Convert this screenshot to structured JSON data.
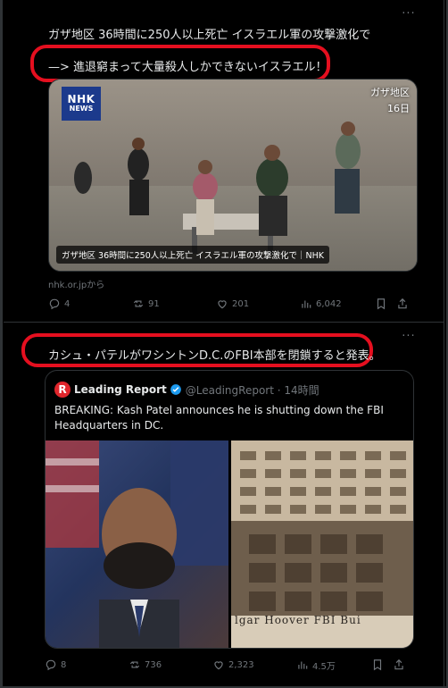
{
  "colors": {
    "highlight_border": "#e50f1f",
    "muted_text": "#71767b",
    "brand_nhk": "#1c3a8c",
    "leading_report_red": "#e0262c"
  },
  "post1": {
    "more_label": "···",
    "headline": "ガザ地区 36時間に250人以上死亡 イスラエル軍の攻撃激化で",
    "comment": "—> 進退窮まって大量殺人しかできないイスラエル！",
    "video": {
      "nhk_logo_top": "NHK",
      "nhk_logo_bottom": "NEWS",
      "location": "ガザ地区",
      "date": "16日",
      "caption": "ガザ地区 36時間に250人以上死亡 イスラエル軍の攻撃激化で｜NHK"
    },
    "source": "nhk.or.jpから",
    "actions": {
      "replies": "4",
      "reposts": "91",
      "likes": "201",
      "views": "6,042"
    }
  },
  "post2": {
    "more_label": "···",
    "comment": "カシュ・パテルがワシントンD.C.のFBI本部を閉鎖すると発表。",
    "quote": {
      "logo_letter": "R",
      "name": "Leading Report",
      "handle": "@LeadingReport · 14時間",
      "text": "BREAKING: Kash Patel announces he is shutting down the FBI Headquarters in DC.",
      "building_sign": "lgar Hoover FBI Bui"
    },
    "actions": {
      "replies": "8",
      "reposts": "736",
      "likes": "2,323",
      "views": "4.5万"
    }
  }
}
